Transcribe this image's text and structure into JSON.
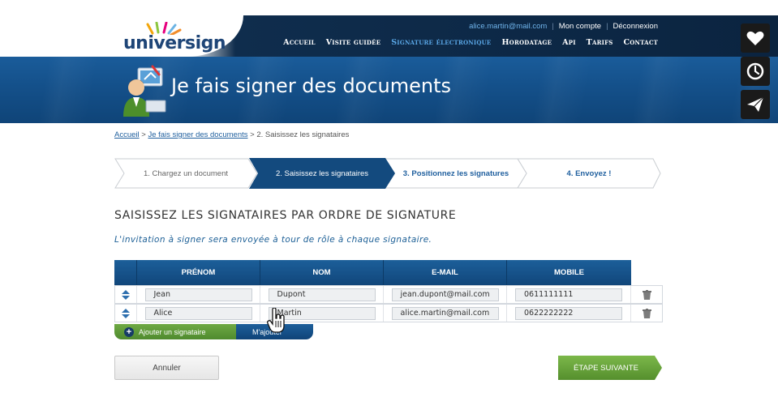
{
  "header": {
    "logo_text": "universign",
    "user_email": "alice.martin@mail.com",
    "account_link": "Mon compte",
    "logout_link": "Déconnexion",
    "nav": [
      "Accueil",
      "Visite guidée",
      "Signature électronique",
      "Horodatage",
      "Api",
      "Tarifs",
      "Contact"
    ],
    "nav_active_index": 2
  },
  "banner": {
    "title": "Je fais signer des documents"
  },
  "side_buttons": [
    "heart-icon",
    "clock-icon",
    "paper-plane-icon"
  ],
  "breadcrumb": {
    "home": "Accueil",
    "sep1": " > ",
    "parent": "Je fais signer des documents",
    "sep2": " > ",
    "current": "2. Saisissez les signataires"
  },
  "steps": [
    {
      "label": "1. Chargez un document",
      "state": "done"
    },
    {
      "label": "2. Saisissez les signataires",
      "state": "active"
    },
    {
      "label": "3. Positionnez les signatures",
      "state": "next"
    },
    {
      "label": "4. Envoyez !",
      "state": "next"
    }
  ],
  "section": {
    "title": "SAISISSEZ LES SIGNATAIRES PAR ORDRE DE SIGNATURE",
    "subtitle": "L'invitation à signer sera envoyée à tour de rôle à chaque signataire."
  },
  "table": {
    "headers": [
      "PRÉNOM",
      "NOM",
      "E-MAIL",
      "MOBILE"
    ],
    "rows": [
      {
        "prenom": "Jean",
        "nom": "Dupont",
        "email": "jean.dupont@mail.com",
        "mobile": "0611111111"
      },
      {
        "prenom": "Alice",
        "nom": "Martin",
        "email": "alice.martin@mail.com",
        "mobile": "0622222222"
      }
    ]
  },
  "add_bar": {
    "add_label": "Ajouter un signataire",
    "me_label": "M'ajouter"
  },
  "buttons": {
    "cancel": "Annuler",
    "next": "ÉTAPE SUIVANTE"
  },
  "colors": {
    "brand_blue": "#14508a",
    "nav_active": "#5aa7e6",
    "green": "#6ea944",
    "link": "#1f5f9e"
  }
}
